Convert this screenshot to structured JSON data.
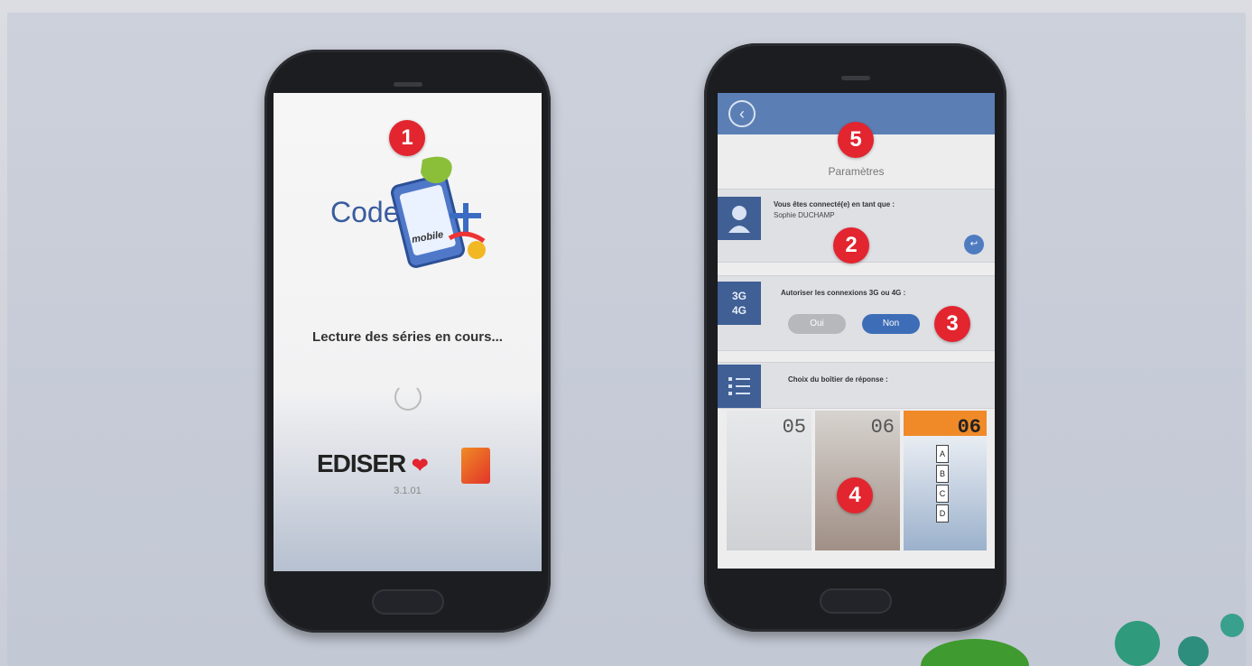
{
  "phone1": {
    "badge": "1",
    "logo_word": "Code",
    "logo_sub": "mobile",
    "loading_text": "Lecture des séries en cours...",
    "brand": "EDISER",
    "version": "3.1.01"
  },
  "phone2": {
    "badge_top": "5",
    "title": "Paramètres",
    "account": {
      "label": "Vous êtes connecté(e) en tant que :",
      "name": "Sophie DUCHAMP",
      "badge": "2",
      "button": "↩"
    },
    "network": {
      "icon_text_1": "3G",
      "icon_text_2": "4G",
      "label": "Autoriser les connexions 3G ou 4G :",
      "options": [
        "Oui",
        "Non"
      ],
      "selected": "Non",
      "badge": "3"
    },
    "answer_box": {
      "label": "Choix du boîtier de réponse :",
      "badge": "4",
      "thumbs": [
        {
          "number": "05"
        },
        {
          "number": "06"
        },
        {
          "number": "06",
          "options": [
            "A",
            "B",
            "C",
            "D"
          ]
        }
      ]
    }
  },
  "colors": {
    "badge_red": "#e2252f",
    "header_blue": "#5b7fb5",
    "icon_blue": "#3f5f95"
  }
}
